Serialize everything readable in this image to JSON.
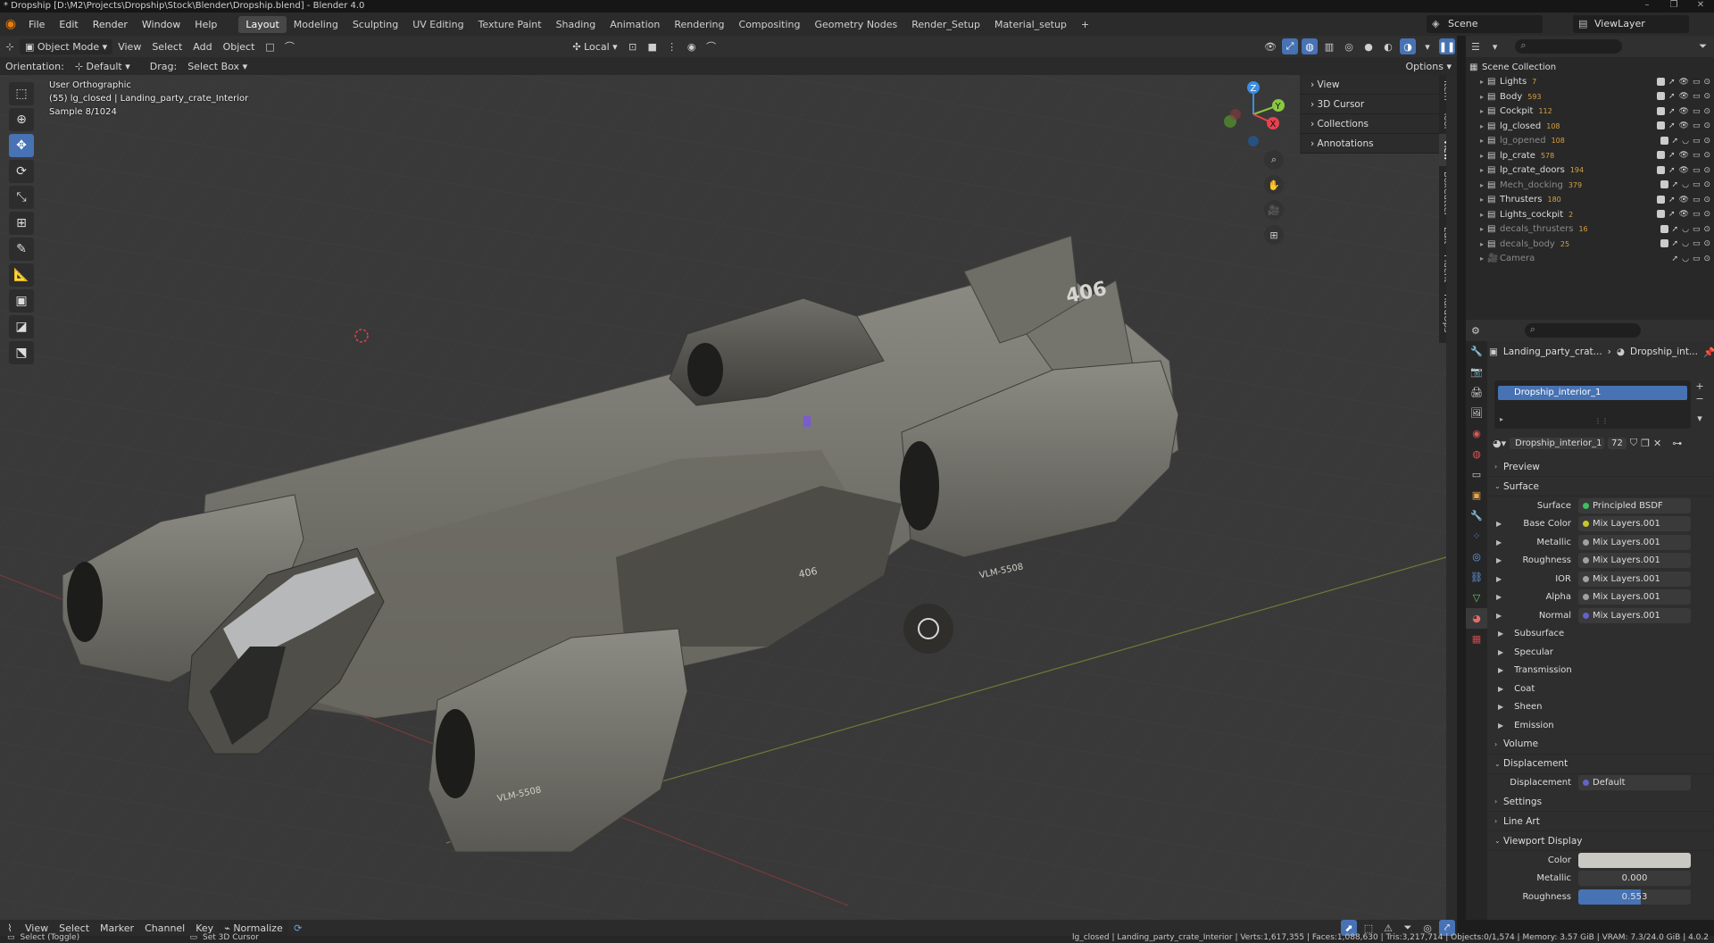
{
  "window": {
    "title": "* Dropship [D:\\M2\\Projects\\Dropship\\Stock\\Blender\\Dropship.blend] - Blender 4.0",
    "controls": [
      "–",
      "❐",
      "✕"
    ]
  },
  "menu": {
    "items": [
      "File",
      "Edit",
      "Render",
      "Window",
      "Help"
    ],
    "workspaces": [
      "Layout",
      "Modeling",
      "Sculpting",
      "UV Editing",
      "Texture Paint",
      "Shading",
      "Animation",
      "Rendering",
      "Compositing",
      "Geometry Nodes",
      "Render_Setup",
      "Material_setup"
    ],
    "active_workspace": "Layout",
    "add_tab": "+",
    "scene": "Scene",
    "view_layer": "ViewLayer"
  },
  "viewport_header": {
    "mode": "Object Mode",
    "menus": [
      "View",
      "Select",
      "Add",
      "Object"
    ],
    "transform_space": "Local",
    "orientation_label": "Orientation:",
    "orientation_value": "Default",
    "drag_label": "Drag:",
    "drag_value": "Select Box",
    "options": "Options"
  },
  "viewport": {
    "view_name": "User Orthographic",
    "object_info": "(55) lg_closed | Landing_party_crate_Interior",
    "sample": "Sample 8/1024",
    "hull_number": "406",
    "hull_number_small": "406",
    "hull_code_1": "VLM-5508",
    "hull_code_2": "VLM-5508",
    "gizmo_axes": [
      "X",
      "Y",
      "Z"
    ]
  },
  "n_panel": {
    "items": [
      "View",
      "3D Cursor",
      "Collections",
      "Annotations"
    ],
    "tabs": [
      "Item",
      "Tool",
      "View",
      "BoxCutter",
      "Edit",
      "Fluent",
      "HardOps"
    ]
  },
  "outliner": {
    "root": "Scene Collection",
    "rows": [
      {
        "name": "Lights",
        "count": "7",
        "dim": false
      },
      {
        "name": "Body",
        "count": "593",
        "dim": false
      },
      {
        "name": "Cockpit",
        "count": "112",
        "dim": false
      },
      {
        "name": "lg_closed",
        "count": "108",
        "dim": false
      },
      {
        "name": "lg_opened",
        "count": "108",
        "dim": true
      },
      {
        "name": "lp_crate",
        "count": "578",
        "dim": false
      },
      {
        "name": "lp_crate_doors",
        "count": "194",
        "dim": false
      },
      {
        "name": "Mech_docking",
        "count": "379",
        "dim": true
      },
      {
        "name": "Thrusters",
        "count": "180",
        "dim": false
      },
      {
        "name": "Lights_cockpit",
        "count": "2",
        "dim": false
      },
      {
        "name": "decals_thrusters",
        "count": "16",
        "dim": true
      },
      {
        "name": "decals_body",
        "count": "25",
        "dim": true
      },
      {
        "name": "Camera",
        "count": "",
        "dim": true
      }
    ]
  },
  "properties": {
    "breadcrumb_object": "Landing_party_crat...",
    "breadcrumb_material": "Dropship_int...",
    "slot_selected": "Dropship_interior_1",
    "material_name": "Dropship_interior_1",
    "users": "72",
    "sections": {
      "preview": "Preview",
      "surface": "Surface",
      "volume": "Volume",
      "displacement": "Displacement",
      "settings": "Settings",
      "line_art": "Line Art",
      "viewport_display": "Viewport Display"
    },
    "surface_label": "Surface",
    "surface_value": "Principled BSDF",
    "inputs": [
      {
        "label": "Base Color",
        "value": "Mix Layers.001",
        "color": "#c7c729"
      },
      {
        "label": "Metallic",
        "value": "Mix Layers.001",
        "color": "#a1a1a1"
      },
      {
        "label": "Roughness",
        "value": "Mix Layers.001",
        "color": "#a1a1a1"
      },
      {
        "label": "IOR",
        "value": "Mix Layers.001",
        "color": "#a1a1a1"
      },
      {
        "label": "Alpha",
        "value": "Mix Layers.001",
        "color": "#a1a1a1"
      },
      {
        "label": "Normal",
        "value": "Mix Layers.001",
        "color": "#6363c7"
      }
    ],
    "subsections": [
      "Subsurface",
      "Specular",
      "Transmission",
      "Coat",
      "Sheen",
      "Emission"
    ],
    "displacement_label": "Displacement",
    "displacement_value": "Default",
    "vp_color_label": "Color",
    "vp_metallic_label": "Metallic",
    "vp_metallic_value": "0.000",
    "vp_roughness_label": "Roughness",
    "vp_roughness_value": "0.553",
    "vp_roughness_fill": 0.553
  },
  "timeline": {
    "items": [
      "View",
      "Select",
      "Marker",
      "Channel",
      "Key"
    ],
    "normalize": "Normalize"
  },
  "status": {
    "left": "Select (Toggle)",
    "middle": "Set 3D Cursor",
    "right": "lg_closed | Landing_party_crate_Interior | Verts:1,617,355 | Faces:1,088,630 | Tris:3,217,714 | Objects:0/1,574 | Memory: 3.57 GiB | VRAM: 7.3/24.0 GiB | 4.0.2"
  },
  "colors": {
    "accent": "#4772b3",
    "blender_orange": "#e87d0d",
    "x_axis": "#e8424e",
    "y_axis": "#8ac73f",
    "z_axis": "#3c8ede"
  }
}
